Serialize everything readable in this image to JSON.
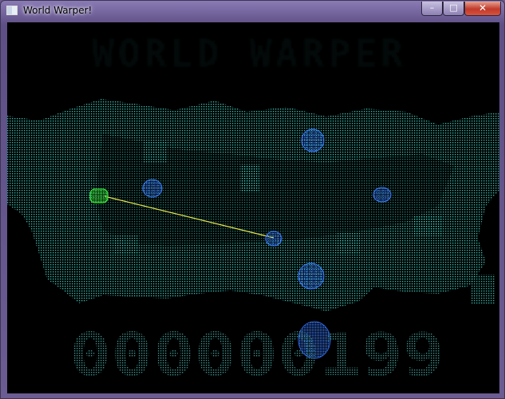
{
  "window": {
    "title": "World Warper!",
    "controls": {
      "minimize": "–",
      "maximize": "□",
      "close": "✕"
    }
  },
  "game": {
    "score": "000000199",
    "title_logo_text": "WORLD WARPER",
    "colors": {
      "terrain": "#3fd0c0",
      "enemy": "#3a7cff",
      "player": "#39e63a",
      "laser": "#e6e64a",
      "score": "#3b8f8a"
    }
  }
}
